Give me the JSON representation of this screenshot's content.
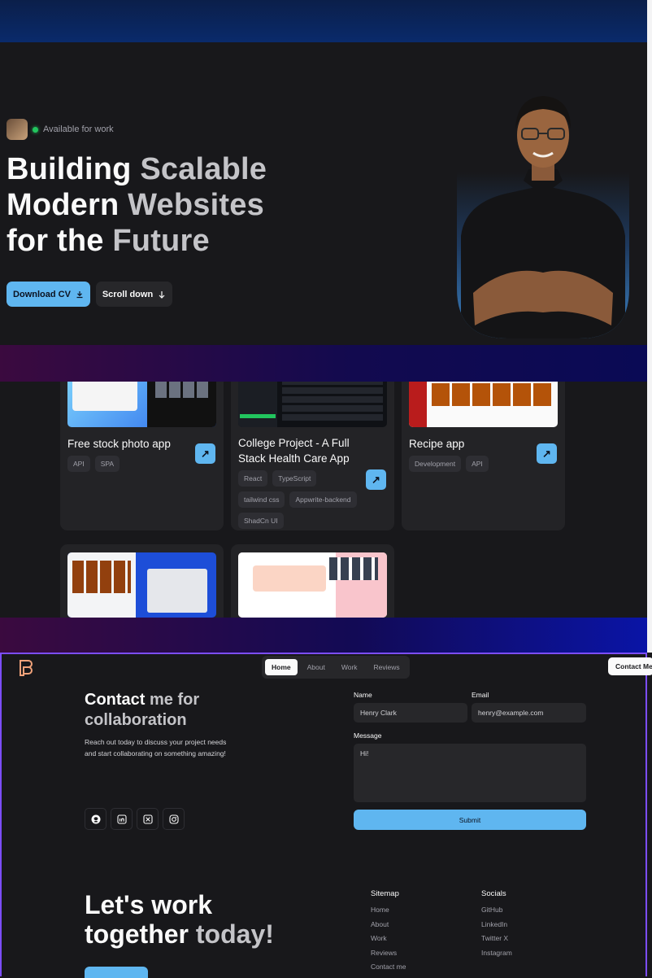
{
  "hero": {
    "availability": "Available for work",
    "headline": {
      "line1_a": "Building ",
      "line1_b": "Scalable",
      "line2_a": "Modern ",
      "line2_b": "Websites",
      "line3_a": "for the ",
      "line3_b": "Future"
    },
    "download_label": "Download CV",
    "scroll_label": "Scroll down"
  },
  "projects": [
    {
      "title": "Free stock photo app",
      "tags": [
        "API",
        "SPA"
      ]
    },
    {
      "title": "College Project - A Full Stack Health Care App",
      "tags": [
        "React",
        "TypeScript",
        "tailwind css",
        "Appwrite-backend",
        "ShadCn UI"
      ]
    },
    {
      "title": "Recipe app",
      "tags": [
        "Development",
        "API"
      ]
    }
  ],
  "nav": {
    "items": [
      "Home",
      "About",
      "Work",
      "Reviews"
    ],
    "active": "Home",
    "contact_label": "Contact Me"
  },
  "contact": {
    "title_a": "Contact",
    "title_b": " me for collaboration",
    "description": "Reach out today to discuss your project needs and start collaborating on something amazing!",
    "socials": [
      "github-icon",
      "linkedin-icon",
      "x-icon",
      "instagram-icon"
    ],
    "form": {
      "name_label": "Name",
      "name_value": "Henry Clark",
      "email_label": "Email",
      "email_value": "henry@example.com",
      "message_label": "Message",
      "message_value": "Hi!",
      "submit_label": "Submit"
    }
  },
  "footer": {
    "cta_a": "Let's work",
    "cta_b": "together",
    "cta_c": " today!",
    "sitemap": {
      "heading": "Sitemap",
      "items": [
        "Home",
        "About",
        "Work",
        "Reviews",
        "Contact me"
      ]
    },
    "socials": {
      "heading": "Socials",
      "items": [
        "GitHub",
        "LinkedIn",
        "Twitter X",
        "Instagram"
      ]
    }
  },
  "colors": {
    "accent": "#5fb6f0",
    "background": "#18181b",
    "card": "#232326",
    "status": "#22c55e",
    "frame": "#7c4dff"
  }
}
